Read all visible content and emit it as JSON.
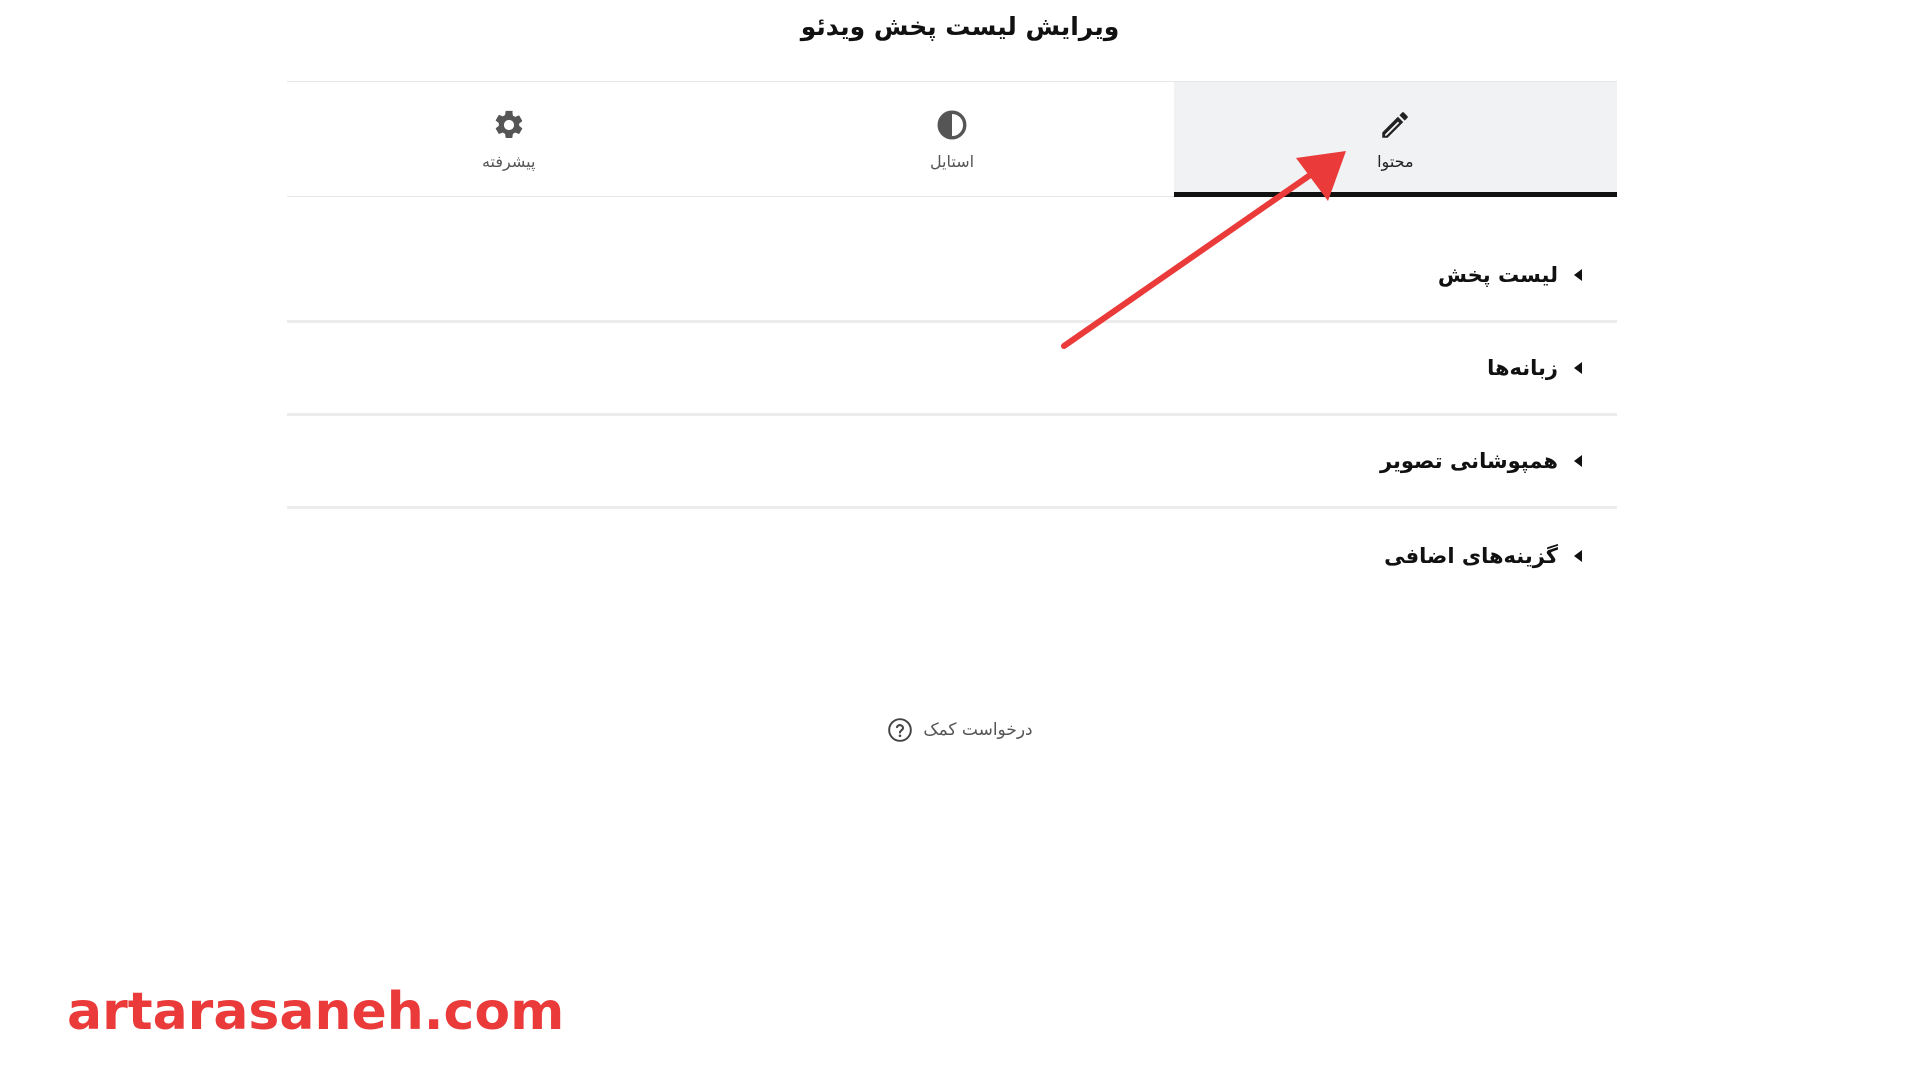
{
  "panel": {
    "title": "ویرایش لیست پخش ویدئو"
  },
  "tabs": [
    {
      "label": "محتوا",
      "icon": "pencil-icon",
      "active": true
    },
    {
      "label": "استایل",
      "icon": "contrast-icon",
      "active": false
    },
    {
      "label": "پیشرفته",
      "icon": "gear-icon",
      "active": false
    }
  ],
  "sections": [
    {
      "label": "لیست پخش",
      "icon": "caret-left-icon"
    },
    {
      "label": "زبانه‌ها",
      "icon": "caret-left-icon"
    },
    {
      "label": "همپوشانی تصویر",
      "icon": "caret-left-icon"
    },
    {
      "label": "گزینه‌های اضافی",
      "icon": "caret-left-icon"
    }
  ],
  "help": {
    "label": "درخواست کمک",
    "icon": "question-circle-icon"
  },
  "annotation": {
    "icon": "red-arrow-icon",
    "color": "#ea3a3a"
  },
  "watermark": {
    "text": "artarasaneh.com",
    "color": "#ea3a3a"
  },
  "colors": {
    "active_tab_bg": "#f1f2f3",
    "active_tab_indicator": "#111111",
    "divider": "#ececec"
  }
}
